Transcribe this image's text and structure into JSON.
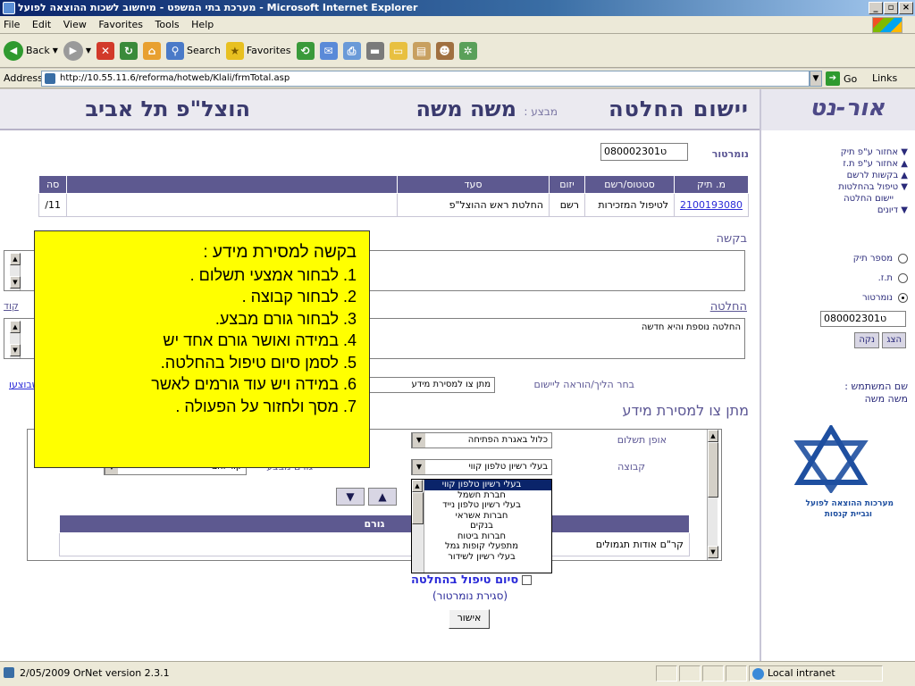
{
  "window": {
    "title": "מערכת בתי המשפט - מיחשוב לשכות ההוצאה לפועל - Microsoft Internet Explorer"
  },
  "menu": [
    "File",
    "Edit",
    "View",
    "Favorites",
    "Tools",
    "Help"
  ],
  "toolbar": {
    "back": "Back",
    "search": "Search",
    "favorites": "Favorites"
  },
  "address": {
    "label": "Address",
    "url": "http://10.55.11.6/reforma/hotweb/Klali/frmTotal.asp",
    "go": "Go",
    "links": "Links"
  },
  "header": {
    "title": "יישום החלטה",
    "executor_label": "מבצע :",
    "executor_name": "משה משה",
    "office": "הוצל\"פ תל אביב"
  },
  "file_number": {
    "label": "נומרטור",
    "value": "ט080002301"
  },
  "case_table": {
    "headers": [
      "מ. תיק",
      "סטטוס/רשם",
      "יזום",
      "סעד",
      "",
      "סה"
    ],
    "row": [
      "2100193080",
      "לטיפול המזכירות",
      "רשם",
      "החלטת ראש ההוצל\"פ",
      "",
      "11/"
    ]
  },
  "request_label": "בקשה",
  "decision_label": "החלטה",
  "decision_text": "החלטה נוספת והיא חדשה",
  "edge_label_right": "קוד",
  "choose_label": "בחר הליך/הוראה ליישום",
  "choose_value": "מתן צו למסירת מידע",
  "procedures_link": "הליכים שבוצעו",
  "order_title": "מתן צו למסירת מידע",
  "payment": {
    "label": "אופן תשלום",
    "value": "כלול באגרת הפתיחה"
  },
  "group": {
    "label": "קבוצה",
    "value": "בעלי רשיון טלפון קווי"
  },
  "executor_factor": {
    "label": "גורם מבצע",
    "value": "קווי זהב"
  },
  "dropdown_options": [
    "בעלי רשיון טלפון קווי",
    "חברת חשמל",
    "בעלי רשיון טלפון נייד",
    "חברות אשראי",
    "בנקים",
    "חברות ביטוח",
    "מתפעלי קופות גמל",
    "בעלי רשיון לשידור"
  ],
  "gorem_table": {
    "header": "גורם",
    "row": "קר\"ם אודות תגמולים"
  },
  "end_treatment": "סיום טיפול בהחלטה",
  "closing": "(סגירת נומרטור)",
  "approve": "אישור",
  "sidebar": {
    "logo": "אור-נט",
    "menu": [
      "אחזור ע\"פ תיק",
      "אחזור ע\"פ ת.ז",
      "בקשות לרשם",
      "טיפול בהחלטות",
      "יישום החלטה",
      "דיונים"
    ],
    "radios": [
      "מספר תיק",
      "ת.ז.",
      "נומרטור"
    ],
    "input_value": "ט080002301",
    "clear": "נקה",
    "show": "הצג",
    "username_label": "שם המשתמש :",
    "username": "משה משה",
    "org_line1": "מערכות ההוצאה לפועל",
    "org_line2": "וגביית קנסות"
  },
  "overlay": {
    "title": "בקשה למסירת מידע :",
    "steps": [
      "1.  לבחור אמצעי תשלום .",
      "2.  לבחור קבוצה .",
      "3.  לבחור גורם מבצע.",
      "4.  במידה ואושר גורם אחד יש",
      "5.  לסמן סיום טיפול בהחלטה.",
      "6.  במידה ויש עוד גורמים לאשר",
      "7.  מסך ולחזור על הפעולה ."
    ]
  },
  "status": {
    "text": "2/05/2009   OrNet version 2.3.1",
    "zone": "Local intranet"
  },
  "colors": {
    "header": "#5d5990",
    "overlay": "#ffff00",
    "title": "#3a3a6e"
  }
}
